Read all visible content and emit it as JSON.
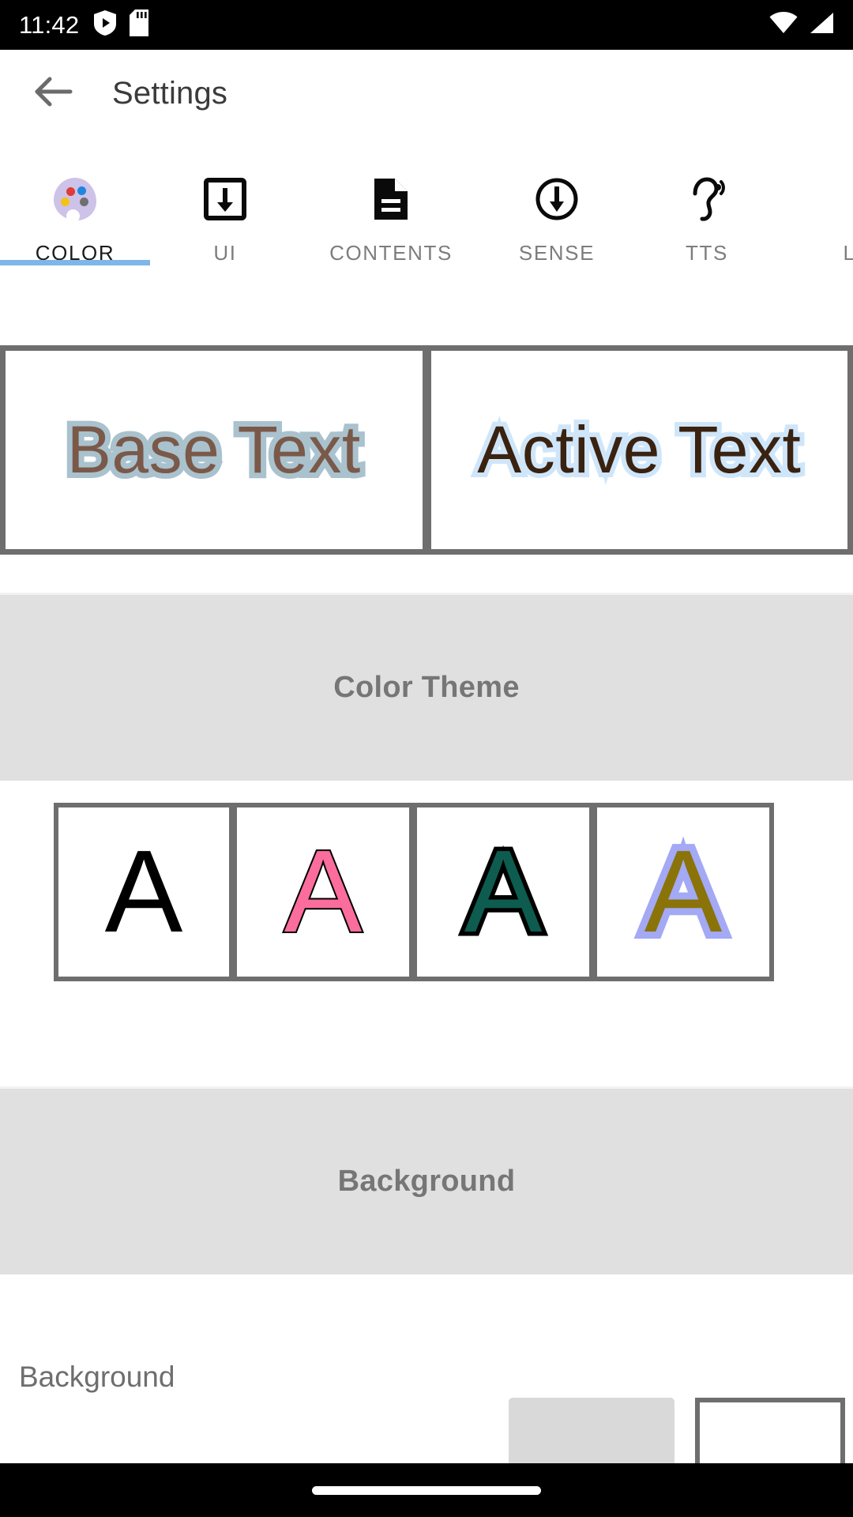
{
  "status_bar": {
    "clock": "11:42",
    "left_icons": [
      "shield-play-icon",
      "sd-card-icon"
    ],
    "right_icons": [
      "wifi-icon",
      "cellular-signal-icon"
    ]
  },
  "toolbar": {
    "back_icon": "back-arrow-icon",
    "title": "Settings"
  },
  "tabs": [
    {
      "label": "COLOR",
      "icon": "palette-icon",
      "active": true
    },
    {
      "label": "UI",
      "icon": "box-download-icon",
      "active": false
    },
    {
      "label": "CONTENTS",
      "icon": "document-icon",
      "active": false
    },
    {
      "label": "SENSE",
      "icon": "circle-download-icon",
      "active": false
    },
    {
      "label": "TTS",
      "icon": "hearing-icon",
      "active": false
    },
    {
      "label": "LA",
      "icon": "none",
      "active": false
    }
  ],
  "preview": [
    {
      "text": "Base Text",
      "name": "base-text-preview",
      "fill_color": "#7a5949",
      "outline_color": "#a9c2ce"
    },
    {
      "text": "Active Text",
      "name": "active-text-preview",
      "fill_color": "#3a2210",
      "outline_color": "#cfe6fa"
    }
  ],
  "sections": {
    "color_theme": {
      "header": "Color Theme",
      "themes": [
        {
          "glyph": "A",
          "fill": "#000000",
          "outline": "#000000",
          "name": "theme-black"
        },
        {
          "glyph": "A",
          "fill": "#fa6d9c",
          "outline": "#000000",
          "name": "theme-pink"
        },
        {
          "glyph": "A",
          "fill": "#0d5c4f",
          "outline": "#000000",
          "name": "theme-teal"
        },
        {
          "glyph": "A",
          "fill": "#8a7309",
          "outline": "#a3a9f5",
          "name": "theme-olive"
        }
      ]
    },
    "background": {
      "header": "Background",
      "row_label": "Background",
      "swatches": [
        {
          "name": "background-swatch-gray",
          "color": "#d9d9d9"
        },
        {
          "name": "background-swatch-white",
          "color": "#ffffff"
        }
      ]
    }
  },
  "nav_bar": {
    "gesture_pill": "home-gesture-pill"
  },
  "accent": {
    "tab_underline": "#7eb6e8",
    "border": "#6e6e6e",
    "band_bg": "#e0e0e0"
  }
}
